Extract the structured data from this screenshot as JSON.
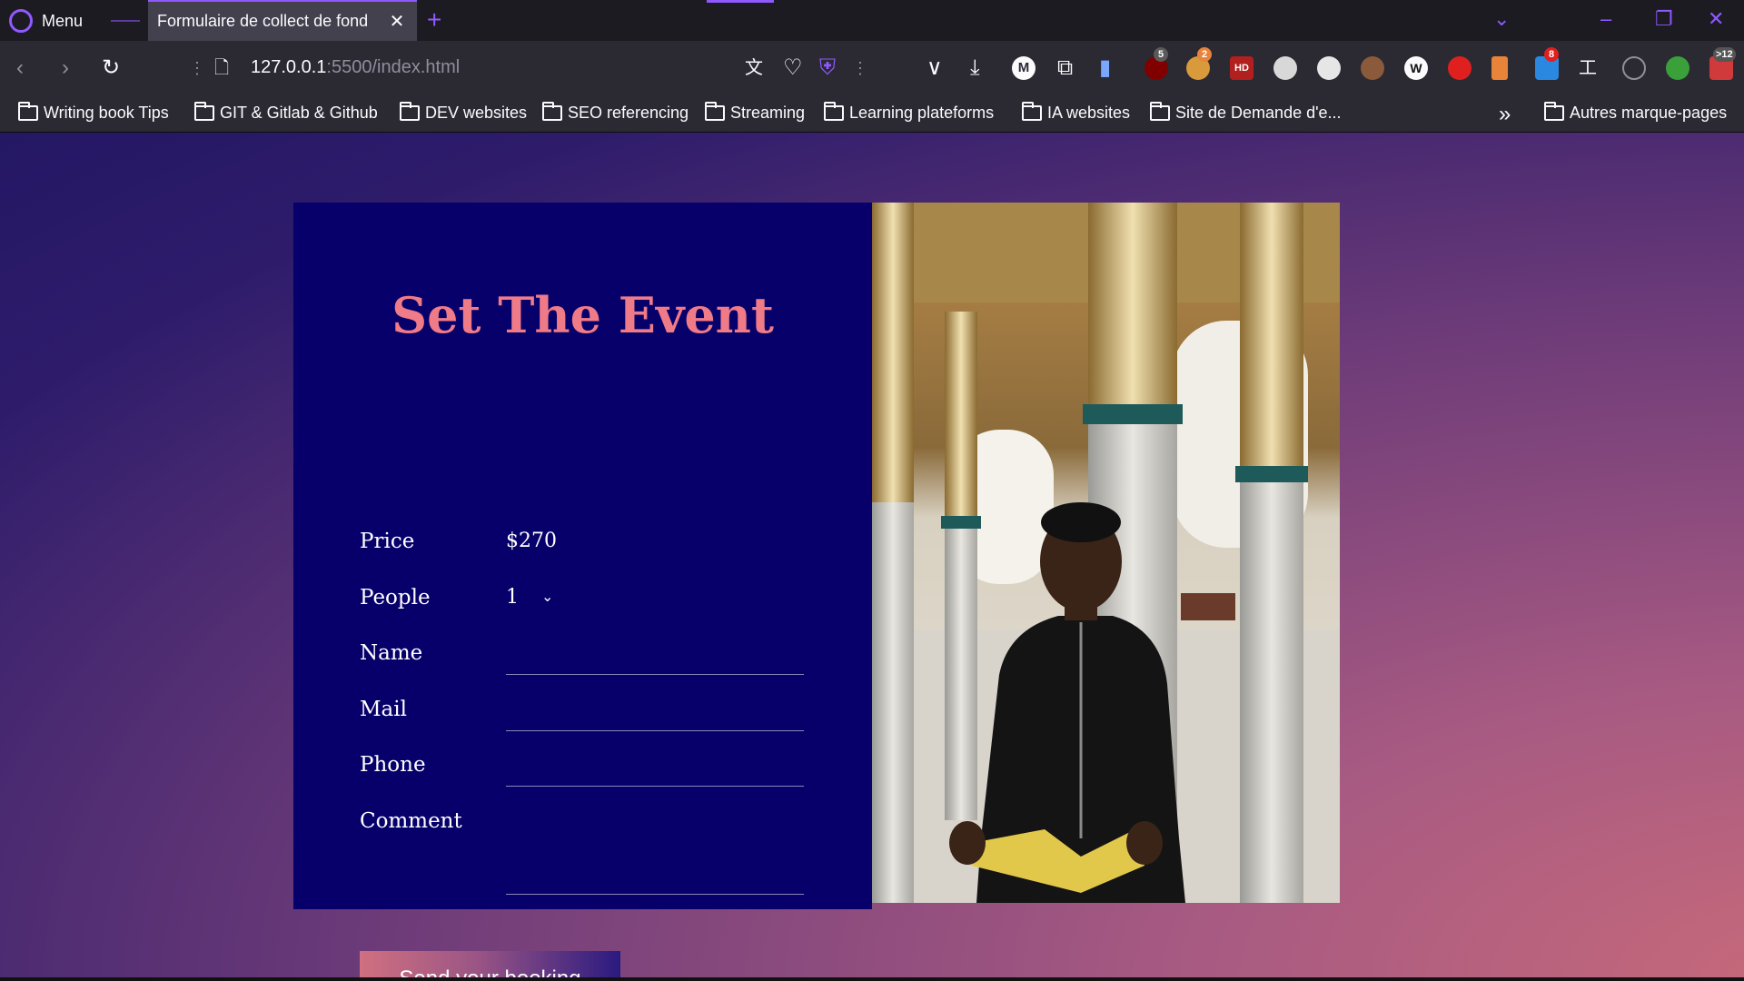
{
  "browser": {
    "menu_label": "Menu",
    "tab_title": "Formulaire de collect de fond",
    "url_host": "127.0.0.1",
    "url_path": ":5500/index.html",
    "bookmarks": [
      "Writing book Tips",
      "GIT & Gitlab & Github",
      "DEV websites",
      "SEO referencing",
      "Streaming",
      "Learning plateforms",
      "IA websites",
      "Site de Demande d'e..."
    ],
    "other_bookmarks": "Autres marque-pages",
    "badges": {
      "ublock": "5",
      "ext2": "2",
      "ext8": "8",
      "mail": ">12"
    }
  },
  "form": {
    "title": "Set The Event",
    "price_label": "Price",
    "price_value": "$270",
    "people_label": "People",
    "people_value": "1",
    "name_label": "Name",
    "mail_label": "Mail",
    "phone_label": "Phone",
    "comment_label": "Comment",
    "submit_label": "Send your booking"
  },
  "colors": {
    "accent": "#9059ff",
    "card_bg": "#08006a",
    "title": "#ef7a88"
  },
  "icons": [
    "menu-logo-icon",
    "back-icon",
    "forward-icon",
    "reload-icon",
    "page-icon",
    "translate-icon",
    "heart-icon",
    "shield-icon",
    "pocket-icon",
    "download-icon",
    "extensions-icon",
    "folder-icon",
    "chevron-double-right-icon"
  ]
}
